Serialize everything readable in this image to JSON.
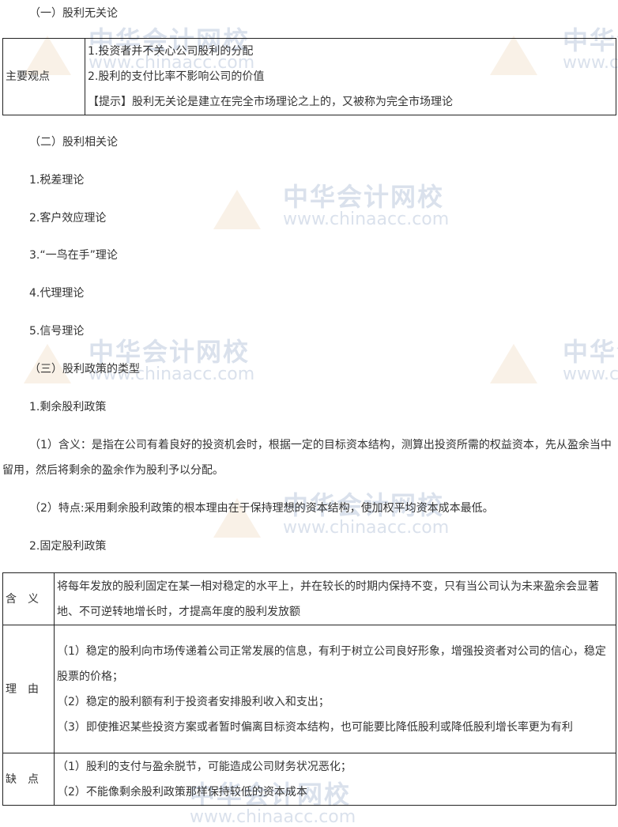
{
  "watermark": {
    "cn": "中华会计网校",
    "en": "www.chinaacc.com"
  },
  "s1": {
    "heading": "（一）股利无关论",
    "table": {
      "label": "主要观点",
      "lines": [
        "1.投资者并不关心公司股利的分配",
        "2.股利的支付比率不影响公司的价值",
        "【提示】股利无关论是建立在完全市场理论之上的，又被称为完全市场理论"
      ]
    }
  },
  "s2": {
    "heading": "（二）股利相关论",
    "items": [
      "1.税差理论",
      "2.客户效应理论",
      "3.“一鸟在手”理论",
      "4.代理理论",
      "5.信号理论"
    ]
  },
  "s3": {
    "heading": "（三）股利政策的类型",
    "sub1": "1.剩余股利政策",
    "p1": "（1）含义：是指在公司有着良好的投资机会时，根据一定的目标资本结构，测算出投资所需的权益资本，先从盈余当中留用，然后将剩余的盈余作为股利予以分配。",
    "p2": "（2）特点:采用剩余股利政策的根本理由在于保持理想的资本结构，使加权平均资本成本最低。",
    "sub2": "2.固定股利政策",
    "table": [
      {
        "label": "含　义",
        "lines": [
          "将每年发放的股利固定在某一相对稳定的水平上，并在较长的时期内保持不变，只有当公司认为未来盈余会显著地、不可逆转地增长时，才提高年度的股利发放额"
        ]
      },
      {
        "label": "理　由",
        "lines": [
          "（1）稳定的股利向市场传递着公司正常发展的信息，有利于树立公司良好形象，增强投资者对公司的信心，稳定股票的价格；",
          "（2）稳定的股利额有利于投资者安排股利收入和支出；",
          "（3）即使推迟某些投资方案或者暂时偏离目标资本结构，也可能要比降低股利或降低股利增长率更为有利"
        ]
      },
      {
        "label": "缺　点",
        "lines": [
          "（1）股利的支付与盈余脱节，可能造成公司财务状况恶化；",
          "（2）不能像剩余股利政策那样保持较低的资本成本"
        ]
      }
    ]
  }
}
